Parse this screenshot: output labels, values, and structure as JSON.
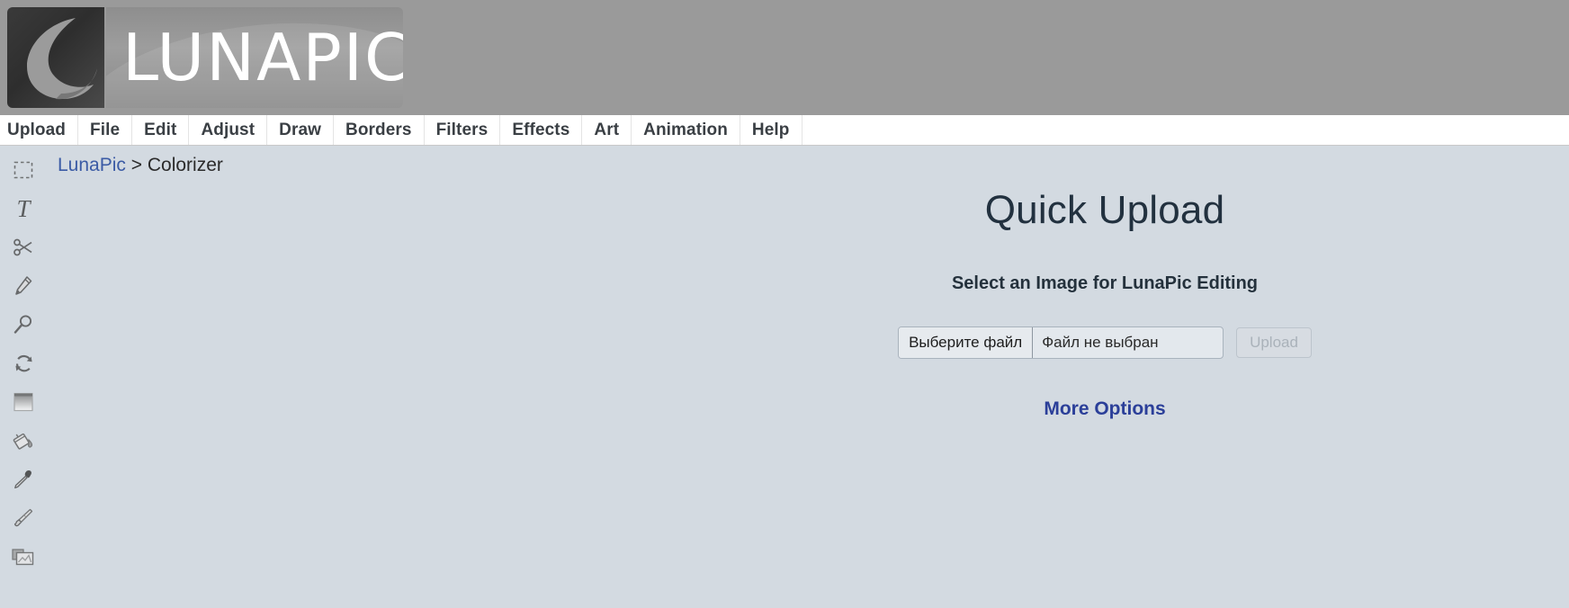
{
  "header": {
    "logo_text": "LUNAPIC",
    "logo_icon": "crescent-moon-icon"
  },
  "menu": {
    "items": [
      {
        "label": "Upload",
        "name": "menu-item-upload"
      },
      {
        "label": "File",
        "name": "menu-item-file"
      },
      {
        "label": "Edit",
        "name": "menu-item-edit"
      },
      {
        "label": "Adjust",
        "name": "menu-item-adjust"
      },
      {
        "label": "Draw",
        "name": "menu-item-draw"
      },
      {
        "label": "Borders",
        "name": "menu-item-borders"
      },
      {
        "label": "Filters",
        "name": "menu-item-filters"
      },
      {
        "label": "Effects",
        "name": "menu-item-effects"
      },
      {
        "label": "Art",
        "name": "menu-item-art"
      },
      {
        "label": "Animation",
        "name": "menu-item-animation"
      },
      {
        "label": "Help",
        "name": "menu-item-help"
      }
    ]
  },
  "breadcrumb": {
    "root_label": "LunaPic",
    "separator": ">",
    "current_label": "Colorizer"
  },
  "toolbar": {
    "tools": [
      {
        "icon": "marquee-select-icon"
      },
      {
        "icon": "text-tool-icon"
      },
      {
        "icon": "scissors-cut-icon"
      },
      {
        "icon": "pencil-icon"
      },
      {
        "icon": "magnifier-zoom-icon"
      },
      {
        "icon": "rotate-refresh-icon"
      },
      {
        "icon": "gradient-fade-icon"
      },
      {
        "icon": "paint-bucket-icon"
      },
      {
        "icon": "eyedropper-icon"
      },
      {
        "icon": "paintbrush-icon"
      },
      {
        "icon": "open-folder-icon"
      }
    ]
  },
  "quick_upload": {
    "title": "Quick Upload",
    "subtitle": "Select an Image for LunaPic Editing",
    "file_choose_label": "Выберите файл",
    "file_name_value": "Файл не выбран",
    "upload_button_label": "Upload",
    "more_options_label": "More Options"
  },
  "colors": {
    "page_background": "#d3dae1",
    "header_background": "#9a9a9a",
    "menu_background": "#ffffff",
    "link_blue": "#3b5ba5",
    "more_options_blue": "#2b3f99",
    "title_dark": "#22313f"
  }
}
